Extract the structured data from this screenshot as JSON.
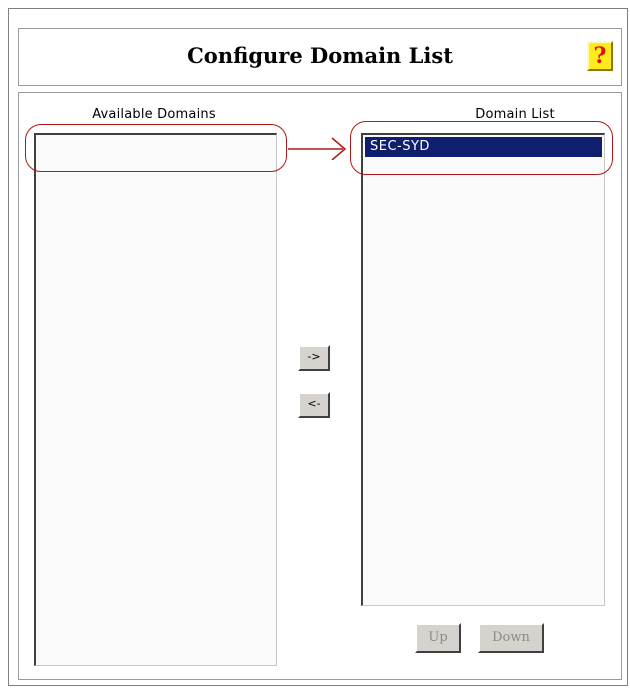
{
  "dialog": {
    "title": "Configure Domain List",
    "help_glyph": "?"
  },
  "available": {
    "label": "Available Domains",
    "items": []
  },
  "domain_list": {
    "label": "Domain List",
    "items": [
      "SEC-SYD"
    ]
  },
  "buttons": {
    "add": "->",
    "remove": "<-",
    "up": "Up",
    "down": "Down"
  },
  "icons": {
    "help": "help-question-icon",
    "annotation_arrow": "right-arrow-annotation-icon"
  },
  "colors": {
    "selection": "#0f1f6e",
    "annotation": "#b01818",
    "help_bg": "#ffea20"
  }
}
